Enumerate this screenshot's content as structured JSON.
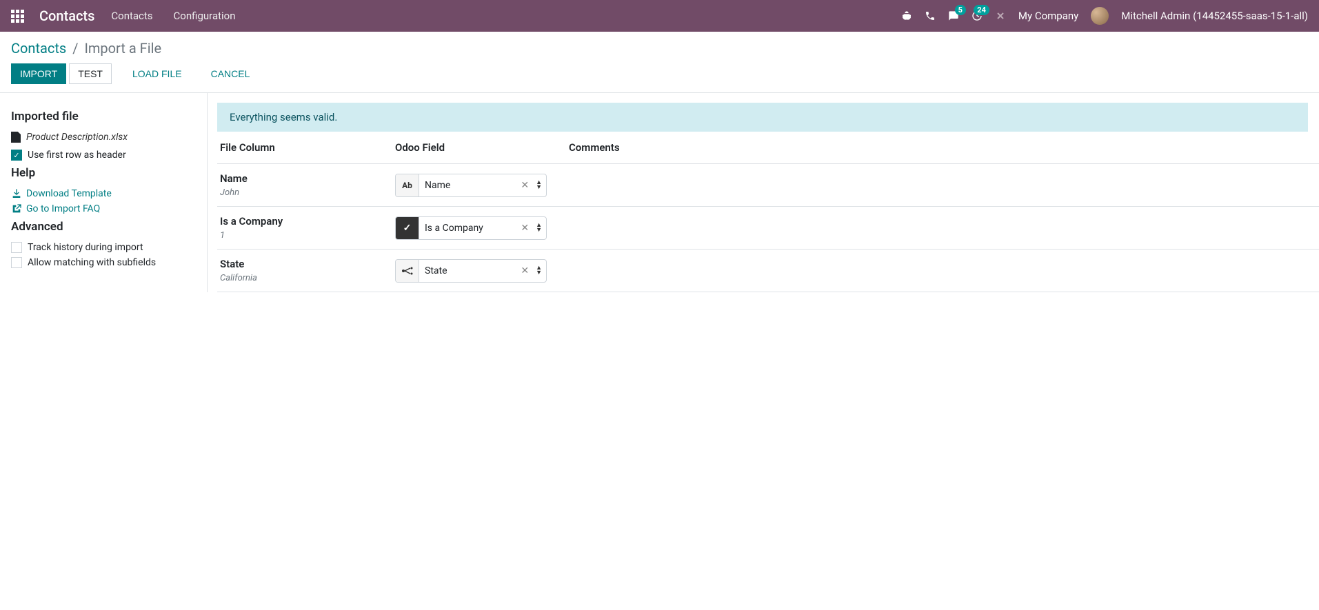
{
  "navbar": {
    "brand": "Contacts",
    "menu": [
      "Contacts",
      "Configuration"
    ],
    "msg_badge": "5",
    "activity_badge": "24",
    "company": "My Company",
    "user": "Mitchell Admin (14452455-saas-15-1-all)"
  },
  "breadcrumb": {
    "parent": "Contacts",
    "current": "Import a File"
  },
  "buttons": {
    "import": "IMPORT",
    "test": "TEST",
    "load": "LOAD FILE",
    "cancel": "CANCEL"
  },
  "sidebar": {
    "imported_title": "Imported file",
    "filename": "Product Description.xlsx",
    "first_row": "Use first row as header",
    "help_title": "Help",
    "download_tpl": "Download Template",
    "faq": "Go to Import FAQ",
    "advanced_title": "Advanced",
    "track": "Track history during import",
    "subfields": "Allow matching with subfields"
  },
  "content": {
    "alert": "Everything seems valid.",
    "headers": {
      "file": "File Column",
      "odoo": "Odoo Field",
      "comments": "Comments"
    },
    "rows": [
      {
        "name": "Name",
        "sample": "John",
        "field": "Name",
        "type": "Ab"
      },
      {
        "name": "Is a Company",
        "sample": "1",
        "field": "Is a Company",
        "type": "check"
      },
      {
        "name": "State",
        "sample": "California",
        "field": "State",
        "type": "rel"
      }
    ]
  }
}
